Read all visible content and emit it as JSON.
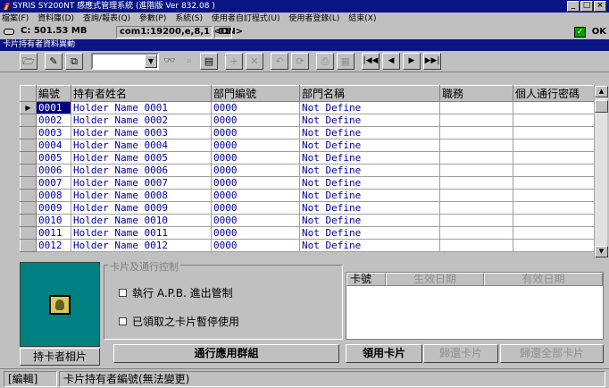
{
  "window": {
    "title": "SYRIS SY200NT 感應式管理系統 (進階版 Ver 832.08 )",
    "controls": [
      "_",
      "□",
      "×"
    ]
  },
  "menu": [
    "檔案(F)",
    "資料庫(D)",
    "查詢/報表(Q)",
    "參數(P)",
    "系統(S)",
    "使用者自訂程式(U)",
    "使用者登錄(L)",
    "結束(X)"
  ],
  "status_top": {
    "disk": "C: 501.53 MB",
    "port": "com1:19200,e,8,1 <ON>",
    "node": "01",
    "ok": "OK"
  },
  "form_title": "卡片持有者資料異動",
  "toolbar": {
    "icons": [
      "open-folder-icon",
      "edit-icon",
      "copy-icon",
      "filter-dropdown",
      "binoculars-icon",
      "find-next-icon",
      "save-icon",
      "add-icon",
      "delete-icon",
      "undo-icon",
      "refresh-icon",
      "print-icon",
      "print-preview-icon",
      "first-record-icon",
      "prev-record-icon",
      "next-record-icon",
      "last-record-icon"
    ],
    "combo_value": ""
  },
  "grid": {
    "columns": [
      "編號",
      "持有者姓名",
      "部門編號",
      "部門名稱",
      "職務",
      "個人通行密碼"
    ],
    "rows": [
      [
        "0001",
        "Holder Name 0001",
        "0000",
        "Not Define",
        "",
        ""
      ],
      [
        "0002",
        "Holder Name 0002",
        "0000",
        "Not Define",
        "",
        ""
      ],
      [
        "0003",
        "Holder Name 0003",
        "0000",
        "Not Define",
        "",
        ""
      ],
      [
        "0004",
        "Holder Name 0004",
        "0000",
        "Not Define",
        "",
        ""
      ],
      [
        "0005",
        "Holder Name 0005",
        "0000",
        "Not Define",
        "",
        ""
      ],
      [
        "0006",
        "Holder Name 0006",
        "0000",
        "Not Define",
        "",
        ""
      ],
      [
        "0007",
        "Holder Name 0007",
        "0000",
        "Not Define",
        "",
        ""
      ],
      [
        "0008",
        "Holder Name 0008",
        "0000",
        "Not Define",
        "",
        ""
      ],
      [
        "0009",
        "Holder Name 0009",
        "0000",
        "Not Define",
        "",
        ""
      ],
      [
        "0010",
        "Holder Name 0010",
        "0000",
        "Not Define",
        "",
        ""
      ],
      [
        "0011",
        "Holder Name 0011",
        "0000",
        "Not Define",
        "",
        ""
      ],
      [
        "0012",
        "Holder Name 0012",
        "0000",
        "Not Define",
        "",
        ""
      ]
    ],
    "selected_row": 0
  },
  "photo": {
    "button": "持卡者相片"
  },
  "access_control": {
    "legend": "卡片及通行控制",
    "apb_label": "執行 A.P.B. 進出管制",
    "suspend_label": "已領取之卡片暫停使用",
    "apb_checked": false,
    "suspend_checked": false
  },
  "card_list": {
    "columns": [
      "卡號",
      "生效日期",
      "有效日期"
    ]
  },
  "buttons": {
    "access_group": "通行應用群組",
    "issue_card": "領用卡片",
    "return_card": "歸還卡片",
    "return_all": "歸還全部卡片"
  },
  "status_bottom": {
    "mode": "[編輯]",
    "message": "卡片持有者編號(無法變更)"
  },
  "colors": {
    "title_bar": "#0a1484",
    "selection": "#000080",
    "grid_text": "#0000a0",
    "photo_bg": "#008080"
  }
}
